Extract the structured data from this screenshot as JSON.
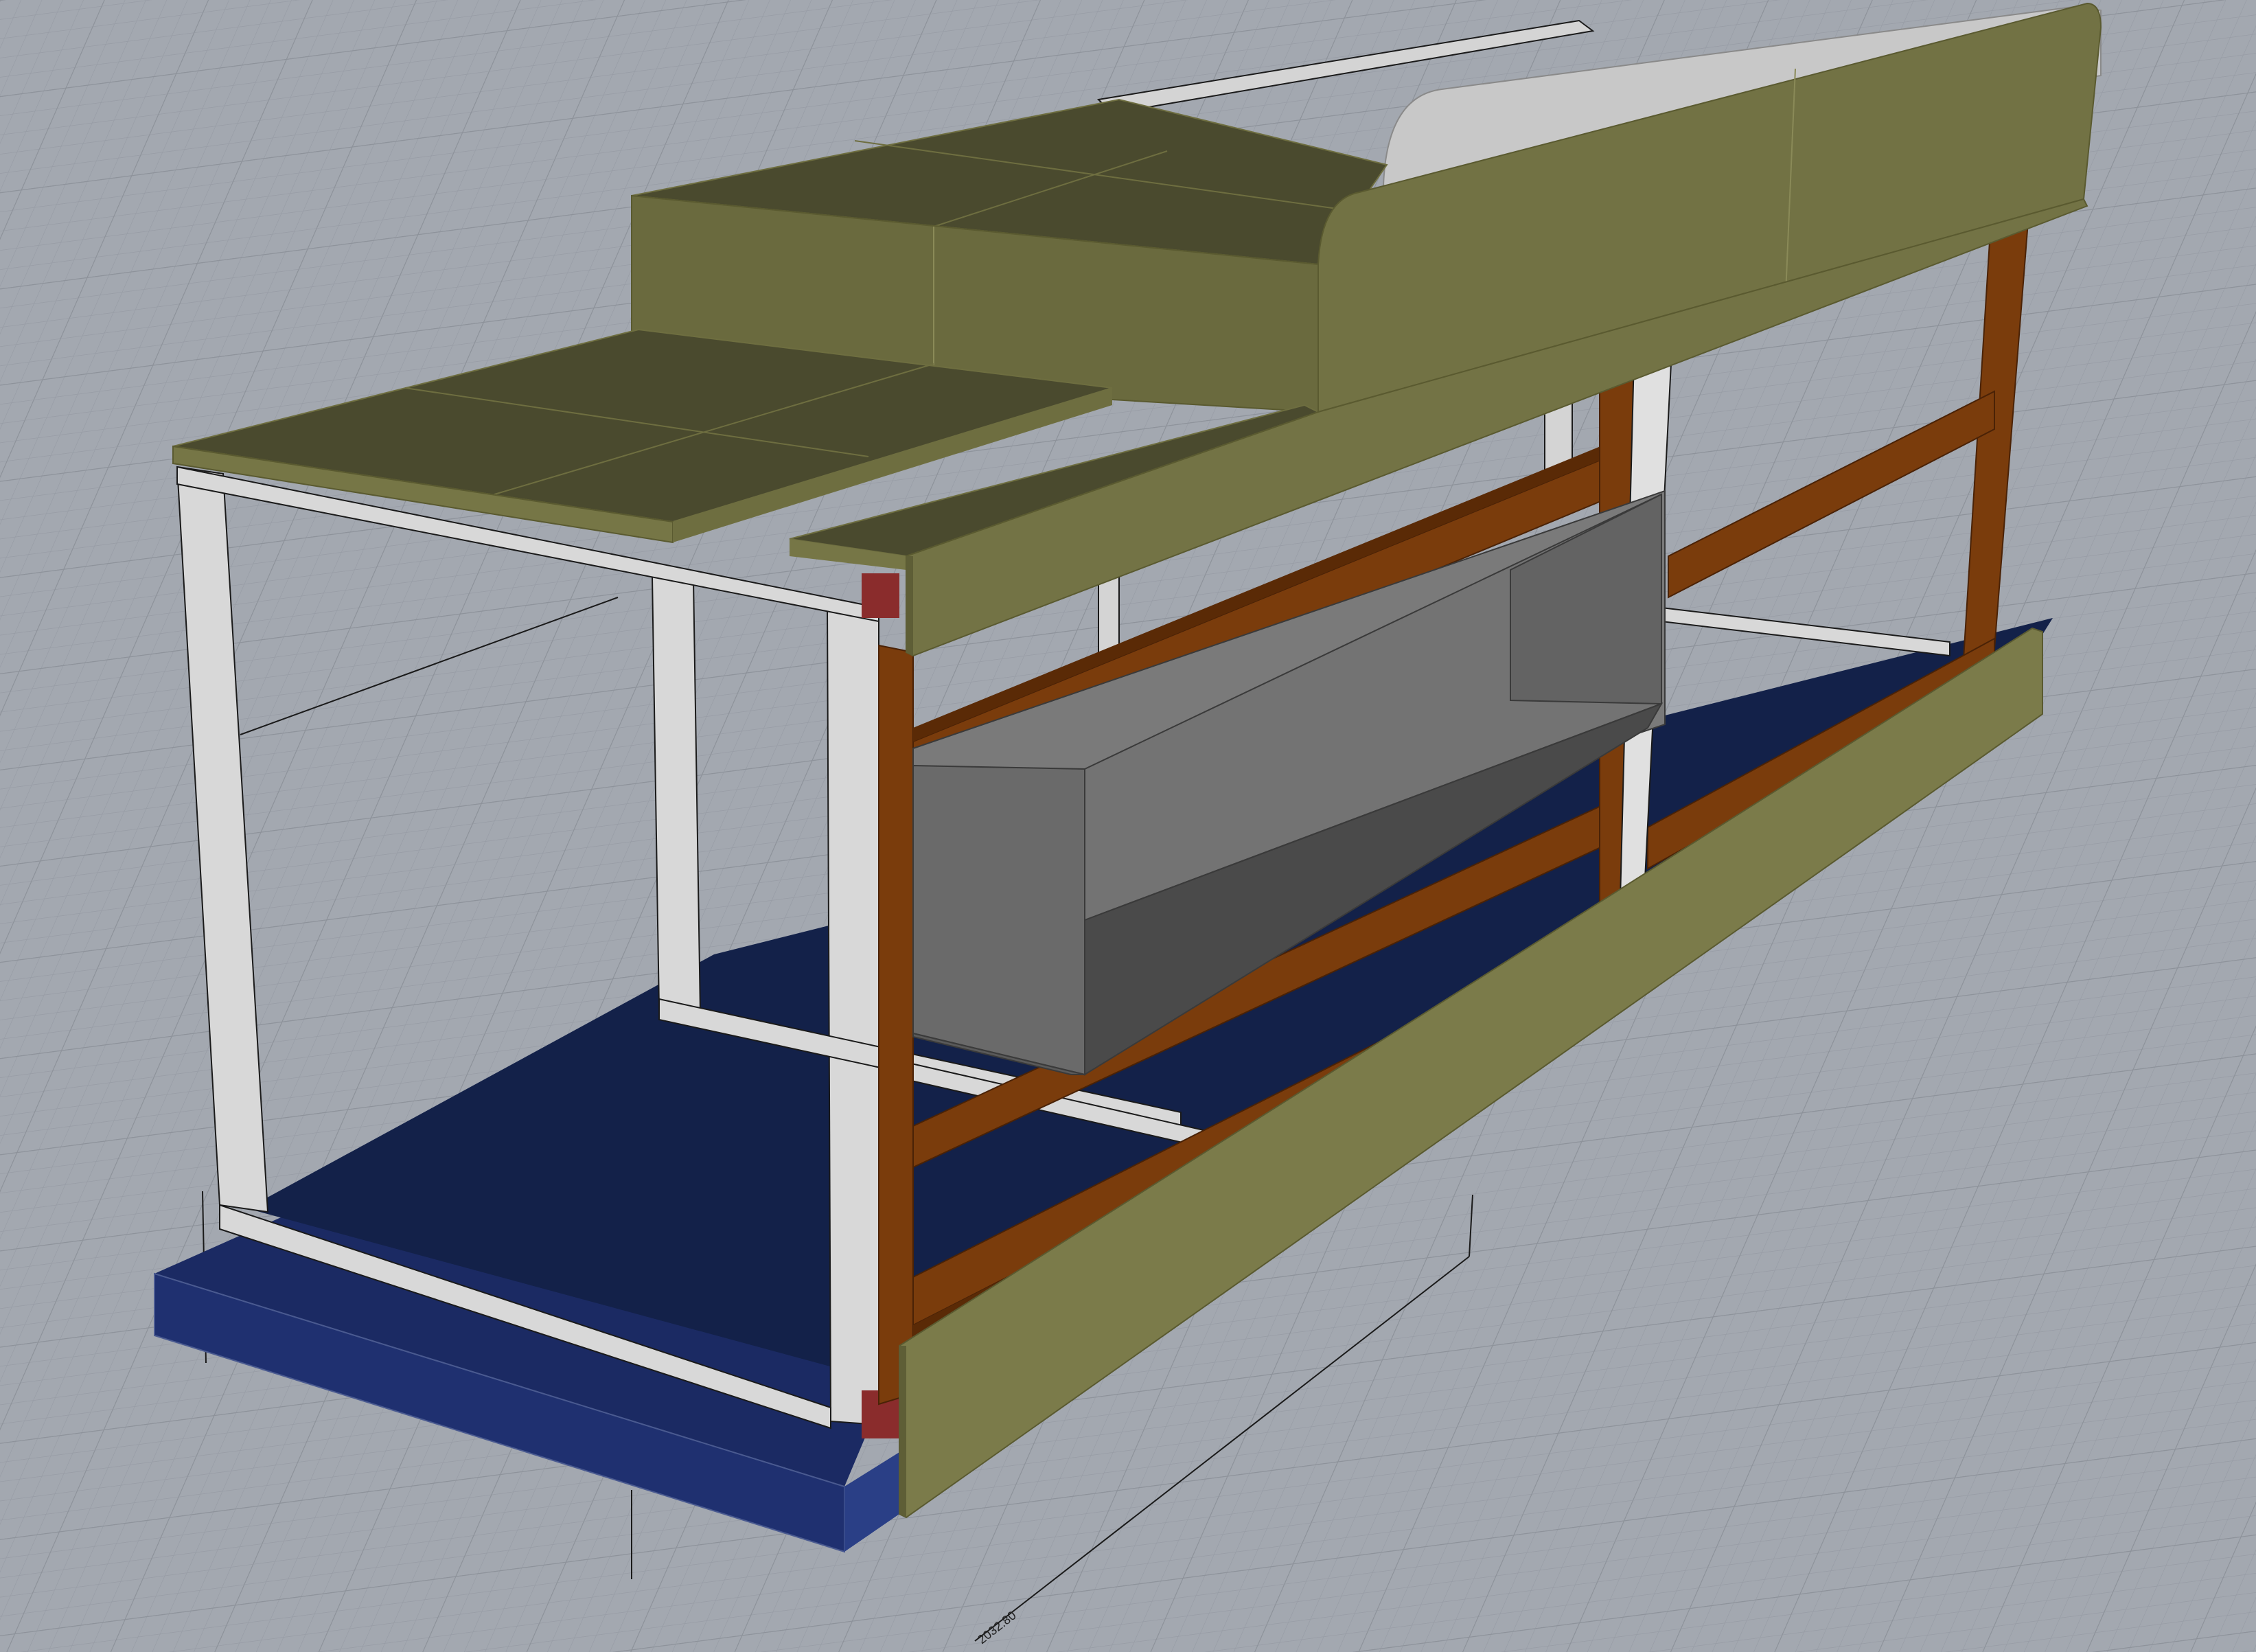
{
  "viewport": {
    "dimension_label": "2032.80"
  },
  "colors": {
    "background": "#a3a8b0",
    "grid_minor": "#979ca5",
    "grid_major": "#8c9199",
    "frame_white": "#d6d6d6",
    "frame_edge": "#1a1a1a",
    "wood_frame": "#7a3a0a",
    "wood_dark": "#5a2a06",
    "olive_panel": "#727244",
    "olive_top": "#4a4a2e",
    "navy_floor": "#13214a",
    "navy_base": "#1d2c66",
    "grey_box": "#6a6a6a",
    "red_joint": "#8a2e2e",
    "white_panel": "#c9c9c9"
  }
}
